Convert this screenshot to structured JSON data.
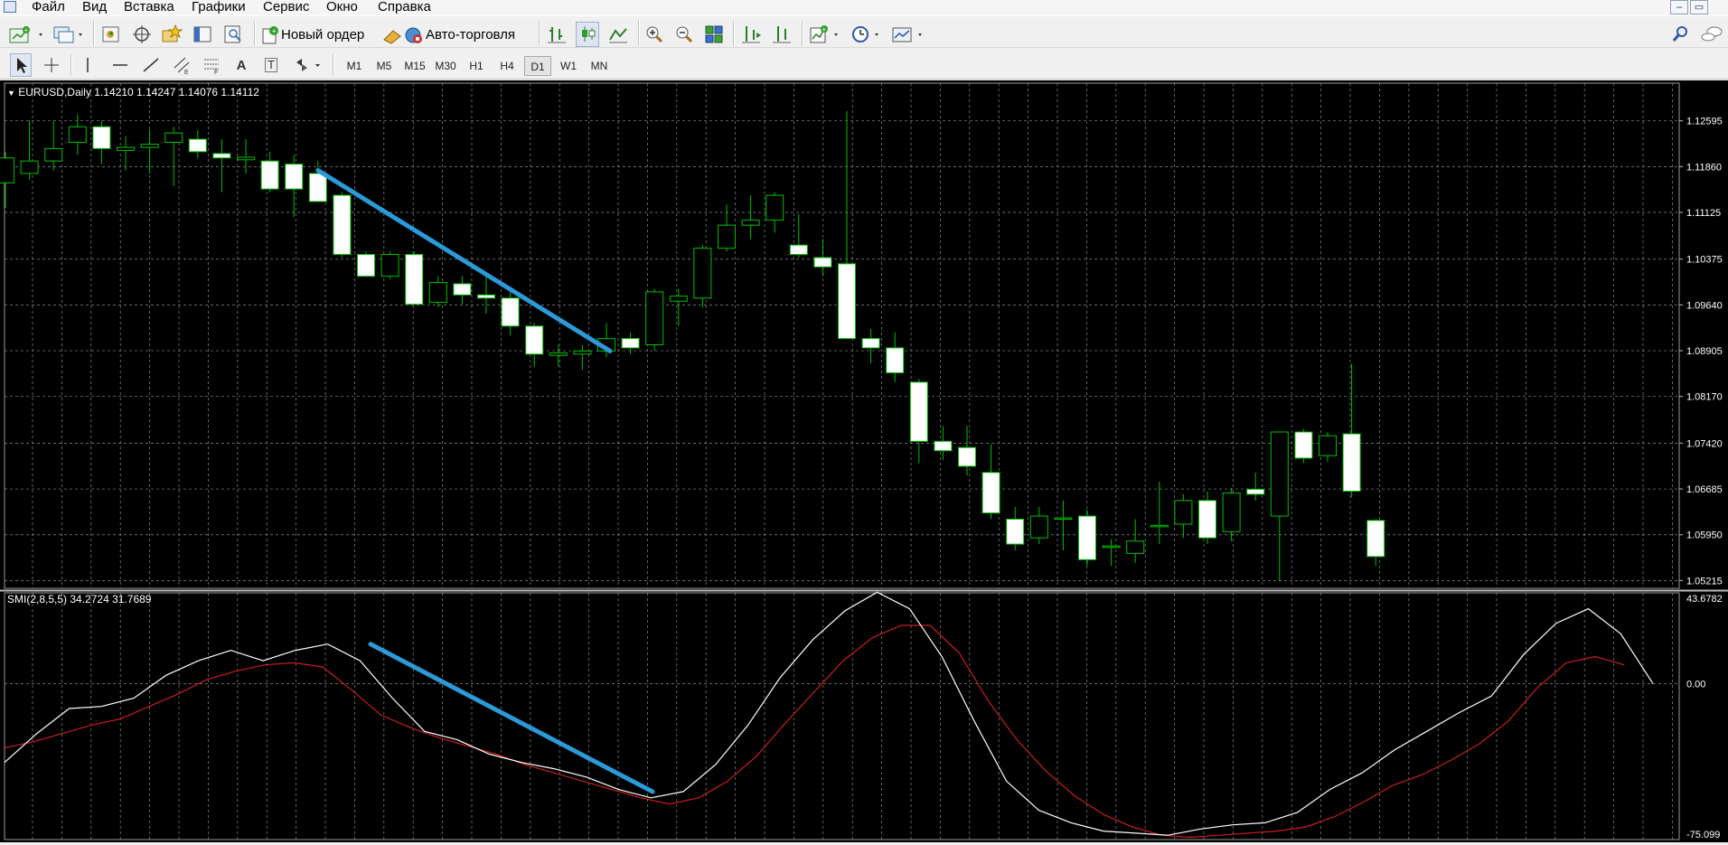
{
  "menu": [
    "Файл",
    "Вид",
    "Вставка",
    "Графики",
    "Сервис",
    "Окно",
    "Справка"
  ],
  "toolbar": {
    "new_order": "Новый ордер",
    "auto_trading": "Авто-торговля"
  },
  "draw_tools": {
    "text_tool": "A",
    "text_label_tool": "T"
  },
  "window_controls": {
    "minimize": "–",
    "restore": "▭"
  },
  "timeframes": [
    "M1",
    "M5",
    "M15",
    "M30",
    "H1",
    "H4",
    "D1",
    "W1",
    "MN"
  ],
  "active_timeframe": "D1",
  "price_chart": {
    "symbol": "EURUSD,Daily",
    "ohlc": "1.14210 1.14247 1.14076 1.14112",
    "price_ticks": [
      "1.12595",
      "1.11860",
      "1.11125",
      "1.10375",
      "1.09640",
      "1.08905",
      "1.08170",
      "1.07420",
      "1.06685",
      "1.05950",
      "1.05215"
    ]
  },
  "indicator": {
    "name": "SMI(2,8,5,5)",
    "values": "34.2724 31.7689",
    "ticks": [
      "43.6782",
      "0.00",
      "-75.099"
    ]
  },
  "colors": {
    "background": "#000000",
    "grid": "#8a8a8a",
    "bull": "#00c000",
    "bear_body": "#ffffff",
    "trendline": "#2a9ad8",
    "smi_line": "#ffffff",
    "signal_line": "#c81e1e"
  },
  "chart_data": {
    "type": "candlestick",
    "ylim": [
      1.0509,
      1.132
    ],
    "candles": [
      {
        "o": 1.116,
        "h": 1.121,
        "l": 1.112,
        "c": 1.12
      },
      {
        "o": 1.1175,
        "h": 1.126,
        "l": 1.1165,
        "c": 1.1195
      },
      {
        "o": 1.1195,
        "h": 1.126,
        "l": 1.118,
        "c": 1.1215
      },
      {
        "o": 1.1225,
        "h": 1.127,
        "l": 1.1205,
        "c": 1.125
      },
      {
        "o": 1.125,
        "h": 1.126,
        "l": 1.119,
        "c": 1.1215
      },
      {
        "o": 1.1212,
        "h": 1.1235,
        "l": 1.118,
        "c": 1.1217
      },
      {
        "o": 1.1217,
        "h": 1.1245,
        "l": 1.1175,
        "c": 1.1222
      },
      {
        "o": 1.1225,
        "h": 1.125,
        "l": 1.1155,
        "c": 1.124
      },
      {
        "o": 1.123,
        "h": 1.1245,
        "l": 1.12,
        "c": 1.121
      },
      {
        "o": 1.1207,
        "h": 1.123,
        "l": 1.1145,
        "c": 1.12
      },
      {
        "o": 1.1197,
        "h": 1.123,
        "l": 1.1175,
        "c": 1.1201
      },
      {
        "o": 1.1195,
        "h": 1.121,
        "l": 1.1145,
        "c": 1.115
      },
      {
        "o": 1.119,
        "h": 1.1205,
        "l": 1.1105,
        "c": 1.115
      },
      {
        "o": 1.1175,
        "h": 1.1195,
        "l": 1.113,
        "c": 1.113
      },
      {
        "o": 1.114,
        "h": 1.1145,
        "l": 1.104,
        "c": 1.1045
      },
      {
        "o": 1.1045,
        "h": 1.105,
        "l": 1.101,
        "c": 1.101
      },
      {
        "o": 1.101,
        "h": 1.105,
        "l": 1.1005,
        "c": 1.1045
      },
      {
        "o": 1.1045,
        "h": 1.105,
        "l": 1.0965,
        "c": 1.0965
      },
      {
        "o": 1.0968,
        "h": 1.101,
        "l": 1.096,
        "c": 1.1
      },
      {
        "o": 1.0998,
        "h": 1.101,
        "l": 1.0965,
        "c": 1.098
      },
      {
        "o": 1.098,
        "h": 1.1015,
        "l": 1.095,
        "c": 1.0975
      },
      {
        "o": 1.0975,
        "h": 1.0985,
        "l": 1.0915,
        "c": 1.093
      },
      {
        "o": 1.093,
        "h": 1.0935,
        "l": 1.0865,
        "c": 1.0885
      },
      {
        "o": 1.0883,
        "h": 1.09,
        "l": 1.0865,
        "c": 1.0887
      },
      {
        "o": 1.0885,
        "h": 1.09,
        "l": 1.086,
        "c": 1.089
      },
      {
        "o": 1.089,
        "h": 1.0935,
        "l": 1.088,
        "c": 1.091
      },
      {
        "o": 1.091,
        "h": 1.092,
        "l": 1.0885,
        "c": 1.0895
      },
      {
        "o": 1.09,
        "h": 1.099,
        "l": 1.089,
        "c": 1.0985
      },
      {
        "o": 1.097,
        "h": 1.099,
        "l": 1.093,
        "c": 1.0978
      },
      {
        "o": 1.0975,
        "h": 1.106,
        "l": 1.096,
        "c": 1.1055
      },
      {
        "o": 1.1055,
        "h": 1.1125,
        "l": 1.105,
        "c": 1.1092
      },
      {
        "o": 1.1092,
        "h": 1.114,
        "l": 1.107,
        "c": 1.11
      },
      {
        "o": 1.11,
        "h": 1.1145,
        "l": 1.108,
        "c": 1.114
      },
      {
        "o": 1.106,
        "h": 1.111,
        "l": 1.104,
        "c": 1.1045
      },
      {
        "o": 1.104,
        "h": 1.107,
        "l": 1.101,
        "c": 1.1025
      },
      {
        "o": 1.103,
        "h": 1.1275,
        "l": 1.091,
        "c": 1.091
      },
      {
        "o": 1.091,
        "h": 1.0925,
        "l": 1.087,
        "c": 1.0895
      },
      {
        "o": 1.0895,
        "h": 1.092,
        "l": 1.084,
        "c": 1.0855
      },
      {
        "o": 1.084,
        "h": 1.0845,
        "l": 1.071,
        "c": 1.0745
      },
      {
        "o": 1.0745,
        "h": 1.077,
        "l": 1.0715,
        "c": 1.073
      },
      {
        "o": 1.0735,
        "h": 1.077,
        "l": 1.069,
        "c": 1.0705
      },
      {
        "o": 1.0695,
        "h": 1.074,
        "l": 1.062,
        "c": 1.063
      },
      {
        "o": 1.062,
        "h": 1.064,
        "l": 1.057,
        "c": 1.058
      },
      {
        "o": 1.059,
        "h": 1.064,
        "l": 1.058,
        "c": 1.0625
      },
      {
        "o": 1.0622,
        "h": 1.065,
        "l": 1.057,
        "c": 1.0622
      },
      {
        "o": 1.0625,
        "h": 1.0635,
        "l": 1.0545,
        "c": 1.0555
      },
      {
        "o": 1.0577,
        "h": 1.0588,
        "l": 1.0545,
        "c": 1.0577
      },
      {
        "o": 1.0565,
        "h": 1.062,
        "l": 1.055,
        "c": 1.0585
      },
      {
        "o": 1.061,
        "h": 1.068,
        "l": 1.058,
        "c": 1.061
      },
      {
        "o": 1.0612,
        "h": 1.066,
        "l": 1.059,
        "c": 1.065
      },
      {
        "o": 1.065,
        "h": 1.0665,
        "l": 1.058,
        "c": 1.059
      },
      {
        "o": 1.06,
        "h": 1.067,
        "l": 1.0585,
        "c": 1.0662
      },
      {
        "o": 1.0668,
        "h": 1.0695,
        "l": 1.065,
        "c": 1.066
      },
      {
        "o": 1.0625,
        "h": 1.076,
        "l": 1.052,
        "c": 1.076
      },
      {
        "o": 1.076,
        "h": 1.0765,
        "l": 1.071,
        "c": 1.0718
      },
      {
        "o": 1.0722,
        "h": 1.076,
        "l": 1.0712,
        "c": 1.0754
      },
      {
        "o": 1.0757,
        "h": 1.087,
        "l": 1.0655,
        "c": 1.0665
      },
      {
        "o": 1.0618,
        "h": 1.062,
        "l": 1.0545,
        "c": 1.056
      }
    ],
    "smi": {
      "ylim": [
        -75.099,
        43.6782
      ],
      "main": [
        -38,
        -24,
        -12,
        -11,
        -7,
        4,
        11,
        16,
        11,
        16,
        19,
        11,
        -7,
        -23,
        -27,
        -34,
        -38,
        -41,
        -45,
        -51,
        -55,
        -52,
        -39,
        -20,
        3,
        21,
        35,
        44,
        36,
        13,
        -18,
        -47,
        -61,
        -67,
        -71,
        -72,
        -73,
        -70,
        -68,
        -67,
        -62,
        -51,
        -43,
        -32,
        -23,
        -14,
        -6,
        14,
        29,
        36,
        24,
        0
      ],
      "signal": [
        -31,
        -28,
        -24,
        -20,
        -17,
        -11,
        -5,
        2,
        6,
        9,
        10,
        8,
        -3,
        -15,
        -21,
        -26,
        -30,
        -34,
        -39,
        -43,
        -47,
        -51,
        -55,
        -58,
        -55,
        -47,
        -35,
        -19,
        -4,
        11,
        22,
        28,
        28,
        15,
        -8,
        -27,
        -42,
        -54,
        -63,
        -69,
        -73,
        -74,
        -73,
        -72,
        -71,
        -69,
        -64,
        -57,
        -49,
        -44,
        -37,
        -29,
        -18,
        -2,
        10,
        13,
        9
      ]
    }
  }
}
